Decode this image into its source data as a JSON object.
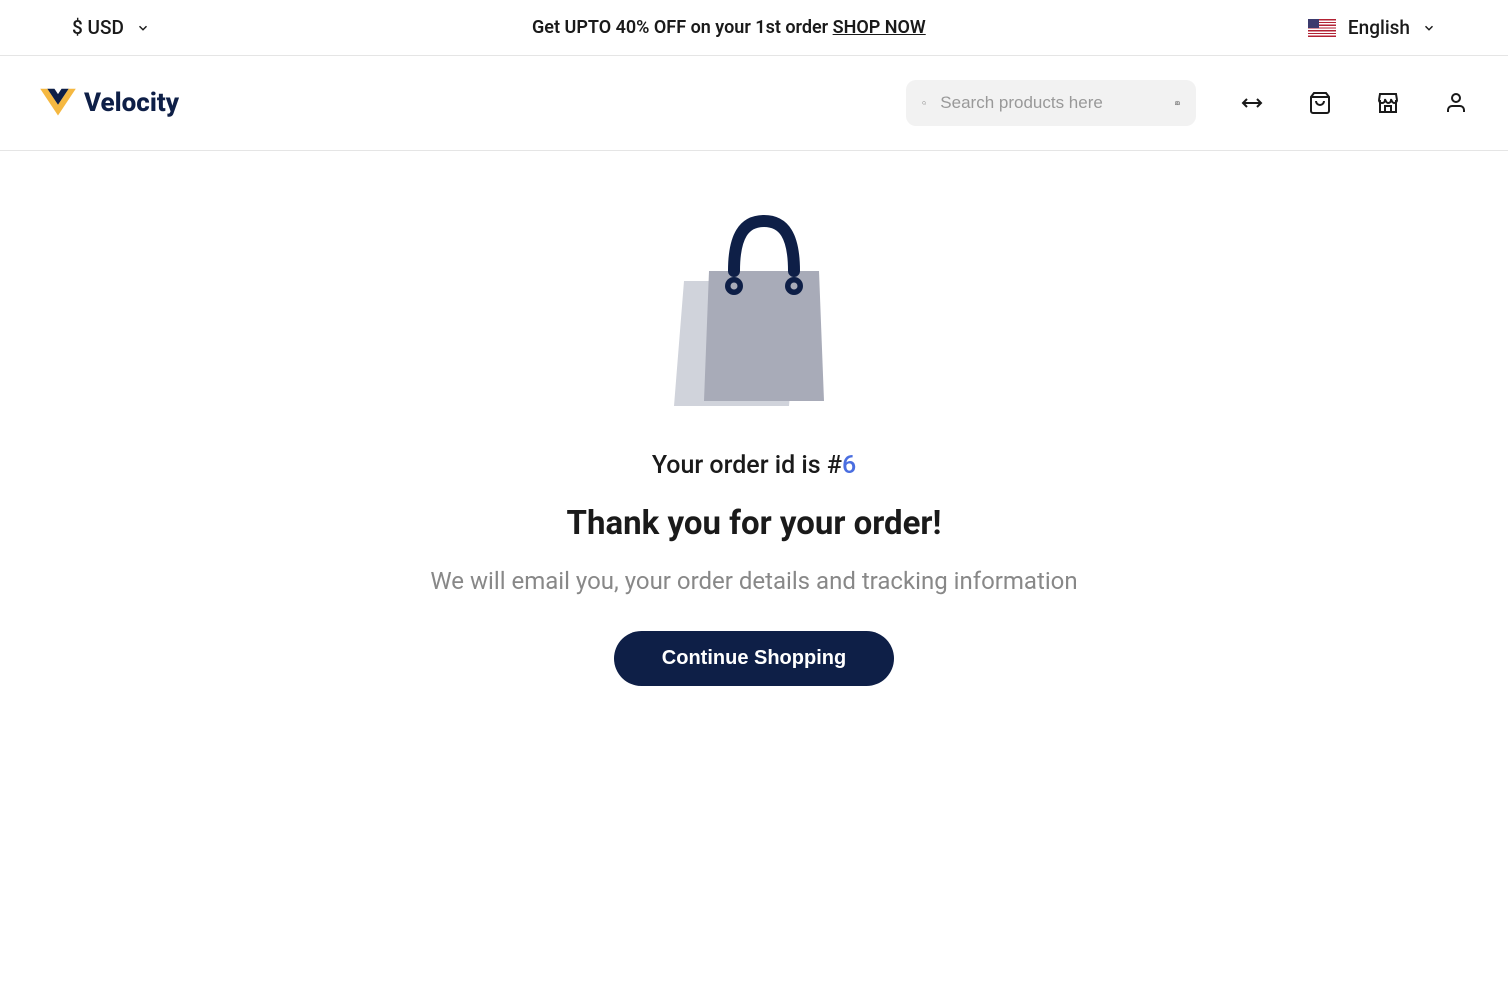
{
  "topbar": {
    "currency": "$ USD",
    "promo_text": "Get UPTO 40% OFF on your 1st order ",
    "promo_link": "SHOP NOW",
    "language": "English"
  },
  "nav": {
    "logo_text": "Velocity",
    "search_placeholder": "Search products here"
  },
  "main": {
    "order_id_prefix": "Your order id is #",
    "order_id": "6",
    "thank_you": "Thank you for your order!",
    "info": "We will email you, your order details and tracking information",
    "continue_btn": "Continue Shopping"
  }
}
